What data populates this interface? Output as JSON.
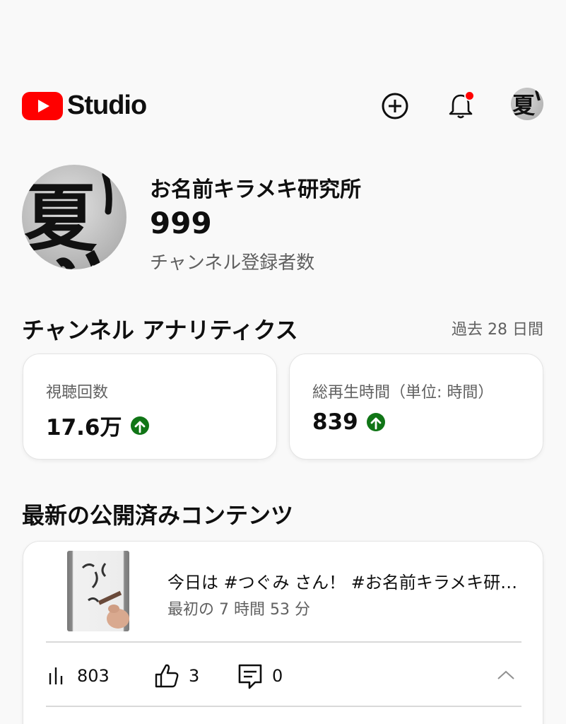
{
  "header": {
    "logo_text": "Studio",
    "icons": [
      "create-icon",
      "notifications-icon",
      "account-avatar"
    ],
    "brand_color": "#ff0000"
  },
  "channel": {
    "name": "お名前キラメキ研究所",
    "subscriber_count": "999",
    "subscriber_label": "チャンネル登録者数",
    "avatar_char": "夏"
  },
  "analytics": {
    "title": "チャンネル アナリティクス",
    "period": "過去 28 日間",
    "metrics": [
      {
        "label": "視聴回数",
        "value": "17.6万",
        "trend": "up"
      },
      {
        "label": "総再生時間（単位: 時間）",
        "value": "839",
        "trend": "up"
      }
    ],
    "trend_color": "#107516"
  },
  "latest": {
    "title": "最新の公開済みコンテンツ",
    "video": {
      "title": "今日は #つぐみ さん！ #お名前キラメキ研究所",
      "meta": "最初の 7 時間 53 分",
      "views": "803",
      "likes": "3",
      "comments": "0"
    }
  }
}
